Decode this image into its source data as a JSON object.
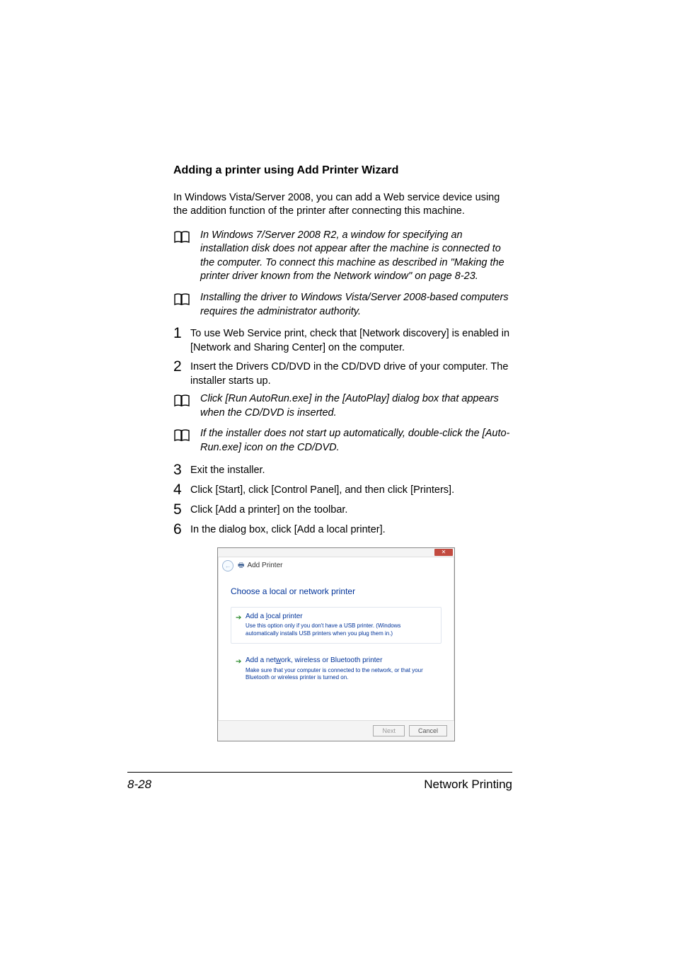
{
  "title": "Adding a printer using Add Printer Wizard",
  "intro": "In Windows Vista/Server 2008, you can add a Web service device using the addition function of the printer after connecting this machine.",
  "notes_top": [
    "In Windows 7/Server 2008 R2, a window for specifying an installation disk does not appear after the machine is connected to the computer. To connect this machine as described in \"Making the printer driver known from the Network window\" on page 8-23.",
    "Installing the driver to Windows Vista/Server 2008-based computers requires the administrator authority."
  ],
  "steps": [
    {
      "n": "1",
      "t": "To use Web Service print, check that [Network discovery] is enabled in [Network and Sharing Center] on the computer."
    },
    {
      "n": "2",
      "t": "Insert the Drivers CD/DVD in the CD/DVD drive of your computer. The installer starts up."
    }
  ],
  "notes_mid": [
    "Click [Run AutoRun.exe] in the [AutoPlay] dialog box that appears when the CD/DVD is inserted.",
    "If the installer does not start up automatically, double-click the [Auto-Run.exe] icon on the CD/DVD."
  ],
  "steps2": [
    {
      "n": "3",
      "t": "Exit the installer."
    },
    {
      "n": "4",
      "t": "Click [Start], click [Control Panel], and then click [Printers]."
    },
    {
      "n": "5",
      "t": "Click [Add a printer] on the toolbar."
    },
    {
      "n": "6",
      "t": "In the dialog box, click [Add a local printer]."
    }
  ],
  "dialog": {
    "header": "Add Printer",
    "prompt": "Choose a local or network printer",
    "opt1_title_pre": "Add a ",
    "opt1_title_u": "l",
    "opt1_title_post": "ocal printer",
    "opt1_desc": "Use this option only if you don't have a USB printer. (Windows automatically installs USB printers when you plug them in.)",
    "opt2_title_pre": "Add a net",
    "opt2_title_u": "w",
    "opt2_title_post": "ork, wireless or Bluetooth printer",
    "opt2_desc": "Make sure that your computer is connected to the network, or that your Bluetooth or wireless printer is turned on.",
    "next": "Next",
    "cancel": "Cancel"
  },
  "footer": {
    "page": "8-28",
    "section": "Network Printing"
  }
}
